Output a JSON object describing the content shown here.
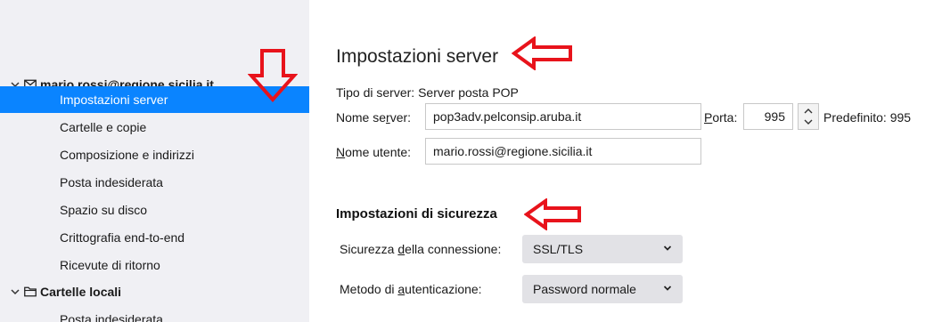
{
  "sidebar": {
    "account": {
      "label": "mario.rossi@regione.sicilia.it"
    },
    "items": [
      {
        "label": "Impostazioni server"
      },
      {
        "label": "Cartelle e copie"
      },
      {
        "label": "Composizione e indirizzi"
      },
      {
        "label": "Posta indesiderata"
      },
      {
        "label": "Spazio su disco"
      },
      {
        "label": "Crittografia end-to-end"
      },
      {
        "label": "Ricevute di ritorno"
      }
    ],
    "local_folders": {
      "label": "Cartelle locali"
    },
    "local_items": [
      {
        "label": "Posta indesiderata"
      }
    ]
  },
  "server": {
    "title": "Impostazioni server",
    "type_label": "Tipo di server: Server posta POP",
    "name_label_pre": "Nome se",
    "name_label_u": "r",
    "name_label_post": "ver:",
    "name_value": "pop3adv.pelconsip.aruba.it",
    "port_label_u": "P",
    "port_label_post": "orta:",
    "port_value": "995",
    "default_port": "Predefinito: 995",
    "user_label_u": "N",
    "user_label_post": "ome utente:",
    "user_value": "mario.rossi@regione.sicilia.it"
  },
  "security": {
    "title": "Impostazioni di sicurezza",
    "conn_label_pre": "Sicurezza ",
    "conn_label_u": "d",
    "conn_label_post": "ella connessione:",
    "conn_value": "SSL/TLS",
    "auth_label_pre": "Metodo di ",
    "auth_label_u": "a",
    "auth_label_post": "utenticazione:",
    "auth_value": "Password normale"
  },
  "colors": {
    "selected": "#0a84ff",
    "annotation_arrow": "#e8131b",
    "sidebar_bg": "#f0f0f4"
  },
  "icons": [
    "chevron-down-icon",
    "envelope-icon",
    "folder-icon",
    "red-arrow-annotation"
  ]
}
